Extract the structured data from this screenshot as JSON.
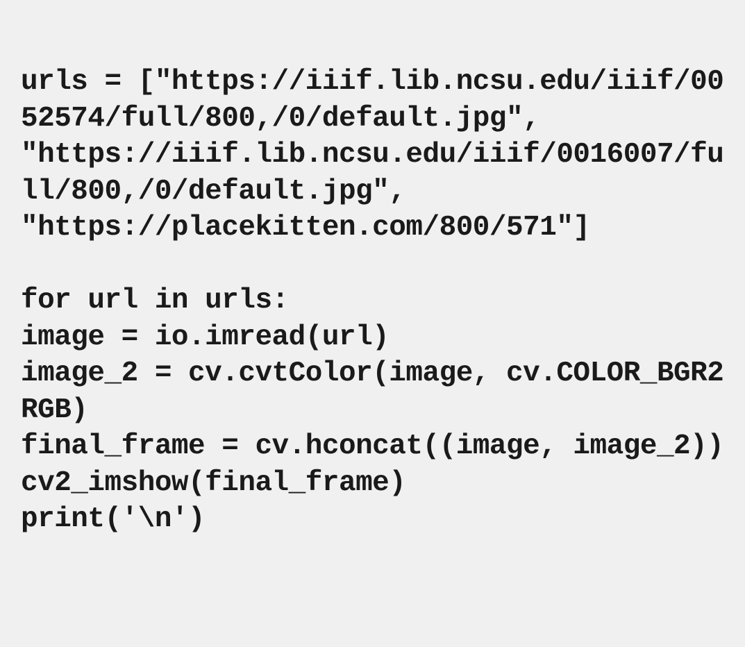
{
  "code": {
    "line1": "urls = [\"https://iiif.lib.ncsu.edu/iiif/0052574/full/800,/0/default.jpg\",",
    "line2": "\"https://iiif.lib.ncsu.edu/iiif/0016007/full/800,/0/default.jpg\",",
    "line3": "\"https://placekitten.com/800/571\"]",
    "line4": "",
    "line5": "for url in urls:",
    "line6": "image = io.imread(url)",
    "line7": "image_2 = cv.cvtColor(image, cv.COLOR_BGR2RGB)",
    "line8": "final_frame = cv.hconcat((image, image_2))",
    "line9": "cv2_imshow(final_frame)",
    "line10": "print('\\n')"
  }
}
